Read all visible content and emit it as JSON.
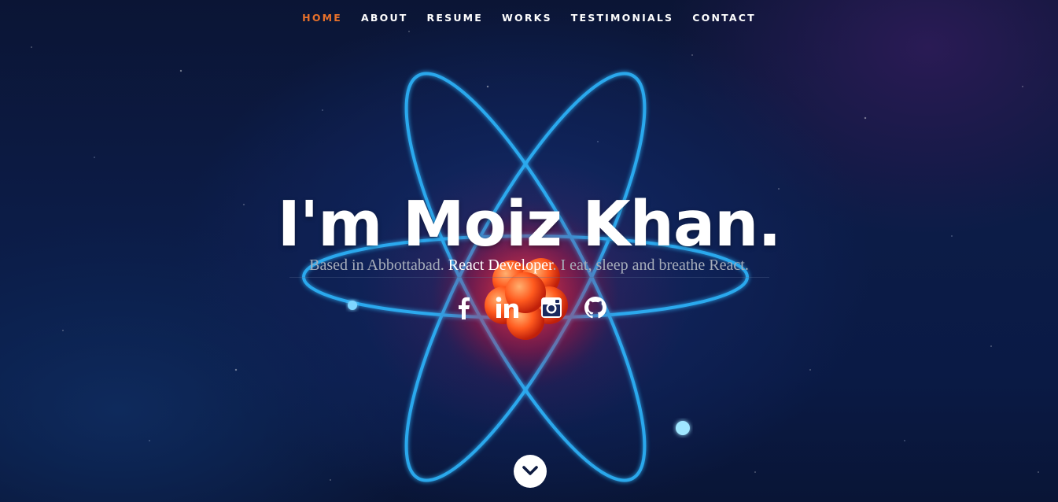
{
  "nav": {
    "items": [
      {
        "label": "HOME",
        "active": true
      },
      {
        "label": "ABOUT",
        "active": false
      },
      {
        "label": "RESUME",
        "active": false
      },
      {
        "label": "WORKS",
        "active": false
      },
      {
        "label": "TESTIMONIALS",
        "active": false
      },
      {
        "label": "CONTACT",
        "active": false
      }
    ],
    "active_color": "#e8712a"
  },
  "hero": {
    "headline": "I'm Moiz Khan.",
    "tagline_prefix": "Based in Abbottabad.",
    "tagline_role": "React Developer",
    "tagline_suffix": ". I eat, sleep and breathe React."
  },
  "social": [
    {
      "icon": "facebook-icon"
    },
    {
      "icon": "linkedin-icon"
    },
    {
      "icon": "instagram-icon"
    },
    {
      "icon": "github-icon"
    }
  ],
  "scroll": {
    "icon": "chevron-down-icon"
  }
}
